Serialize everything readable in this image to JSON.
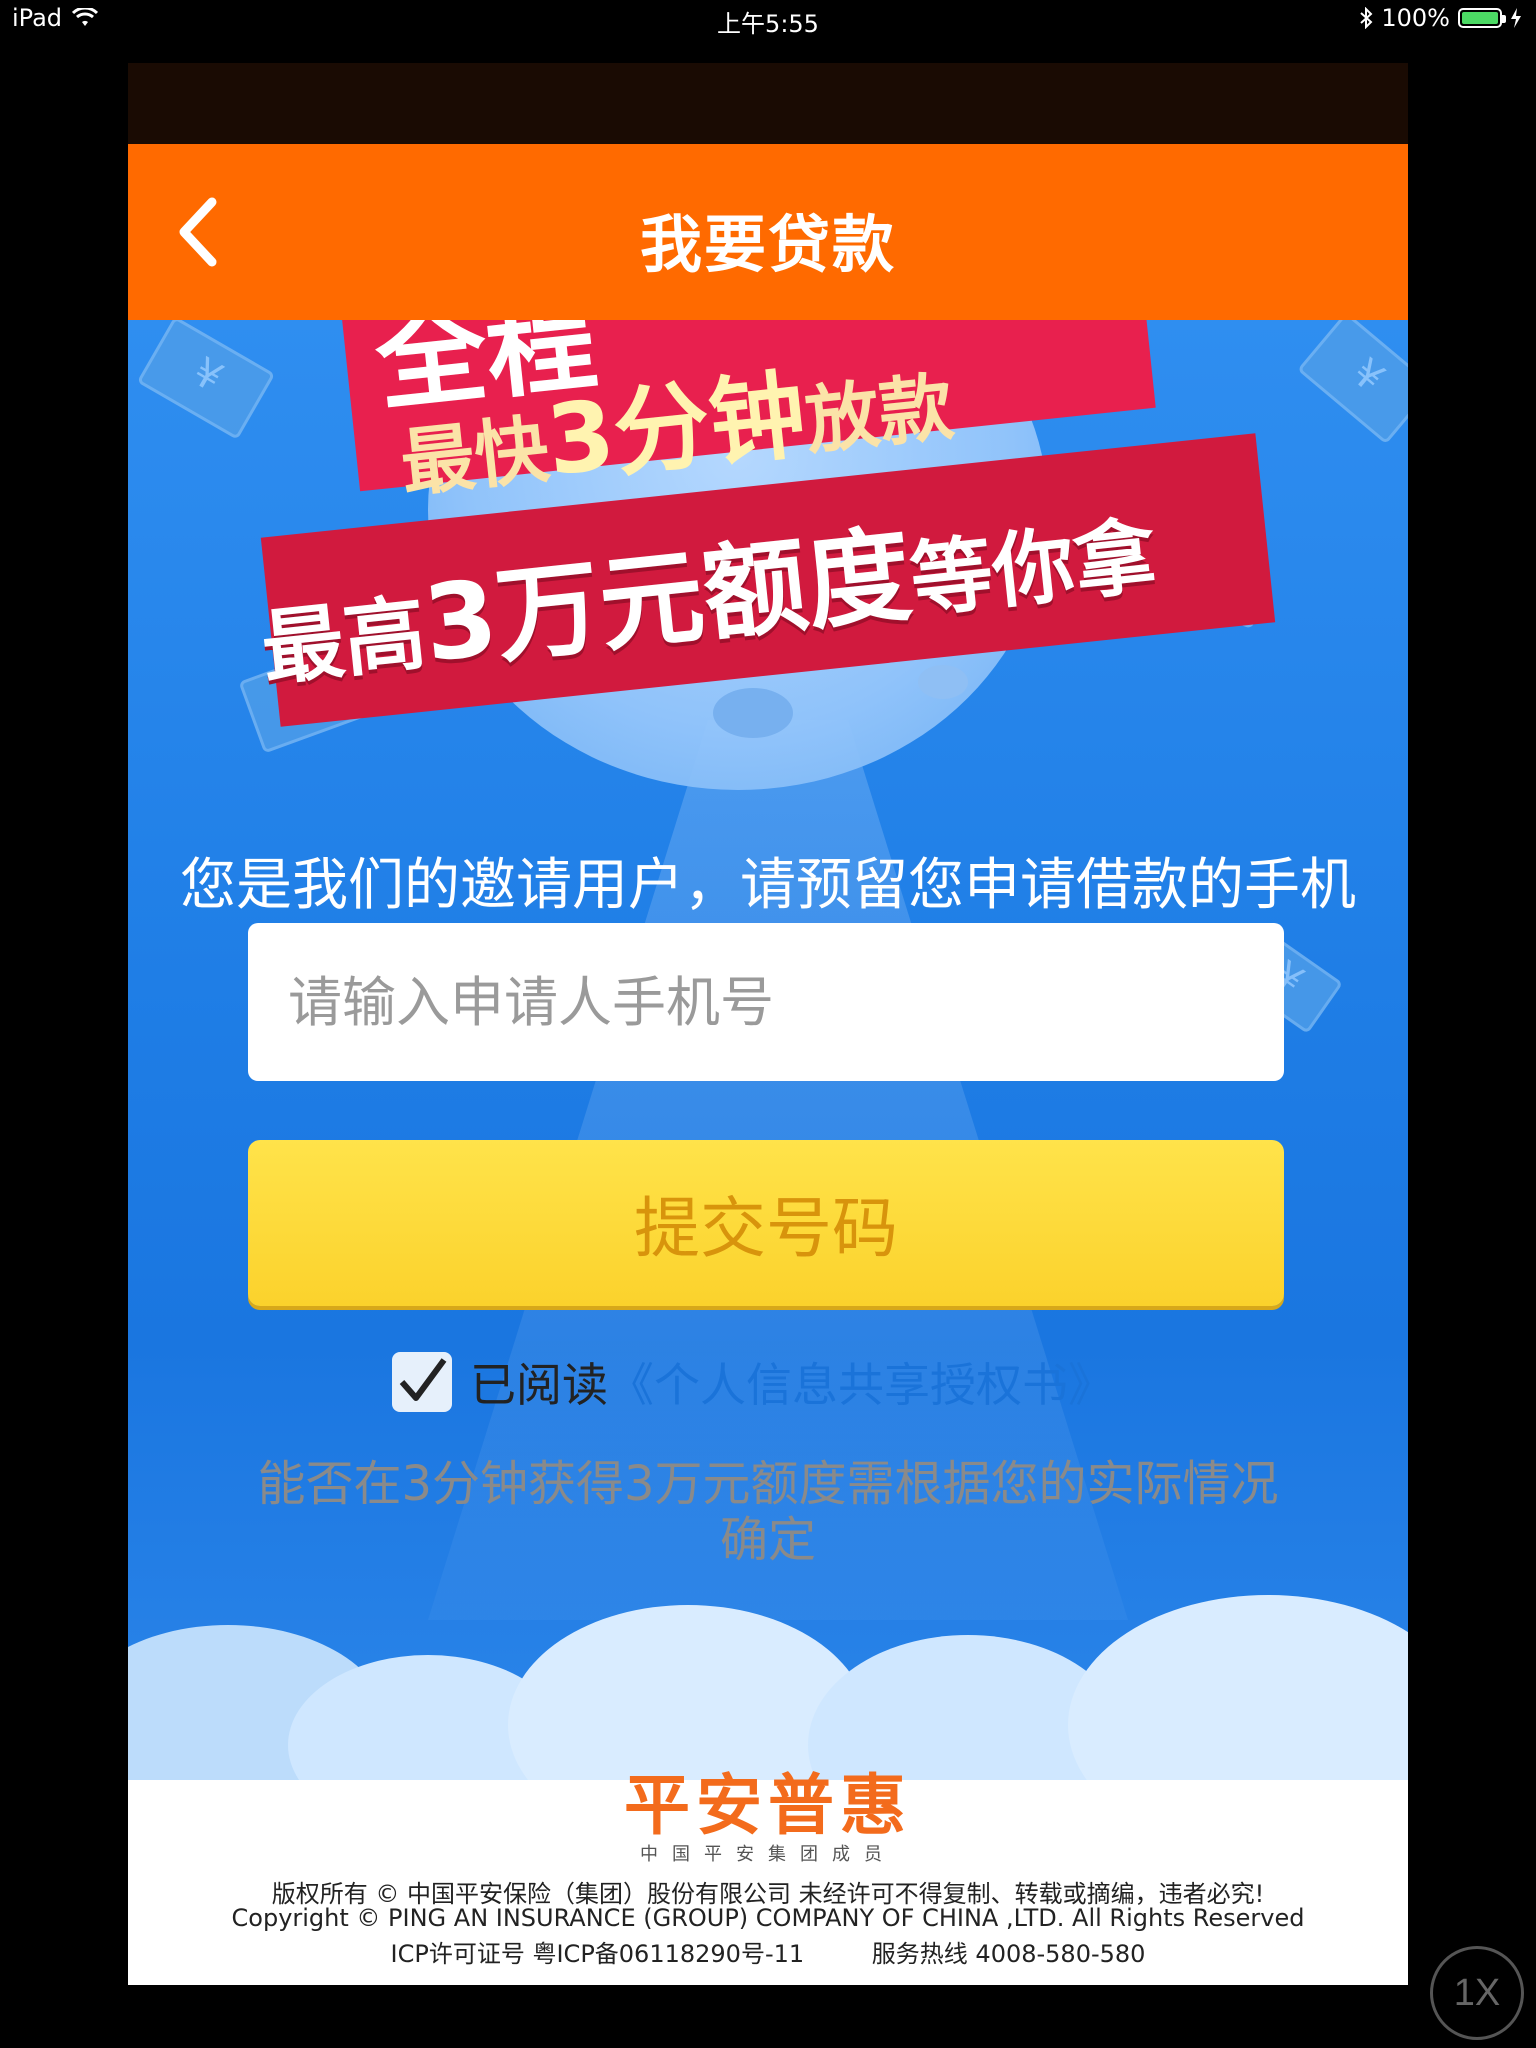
{
  "status_bar": {
    "device": "iPad",
    "time": "上午5:55",
    "battery_percent": "100%",
    "battery_level": 1.0
  },
  "nav": {
    "title": "我要贷款"
  },
  "banner": {
    "line1_prefix": "最快",
    "line1_highlight": "3分钟",
    "line1_suffix": "放款",
    "line2_prefix": "最高",
    "line2_highlight": "3万元额度",
    "line2_suffix": "等你拿"
  },
  "invite_text": "您是我们的邀请用户，请预留您申请借款的手机号码，将有助提高你的借款",
  "phone_input": {
    "placeholder": "请输入申请人手机号",
    "value": ""
  },
  "submit_label": "提交号码",
  "agreement": {
    "checked": true,
    "prefix": "已阅读",
    "link": "《个人信息共享授权书》"
  },
  "disclaimer": "能否在3分钟获得3万元额度需根据您的实际情况确定",
  "footer": {
    "brand": "平安普惠",
    "brand_sub": "中国平安集团成员",
    "copyright_cn": "版权所有 © 中国平安保险（集团）股份有限公司 未经许可不得复制、转载或摘编，违者必究!",
    "copyright_en": "Copyright © PING AN INSURANCE (GROUP) COMPANY OF CHINA ,LTD. All Rights Reserved",
    "icp": "ICP许可证号 粤ICP备06118290号-11",
    "hotline": "服务热线 4008-580-580"
  },
  "zoom_button": "1X",
  "colors": {
    "nav_bg": "#ff6a00",
    "hero_blue": "#1f7ee6",
    "submit_yellow": "#fbd22c",
    "brand_orange": "#f36b1c"
  }
}
